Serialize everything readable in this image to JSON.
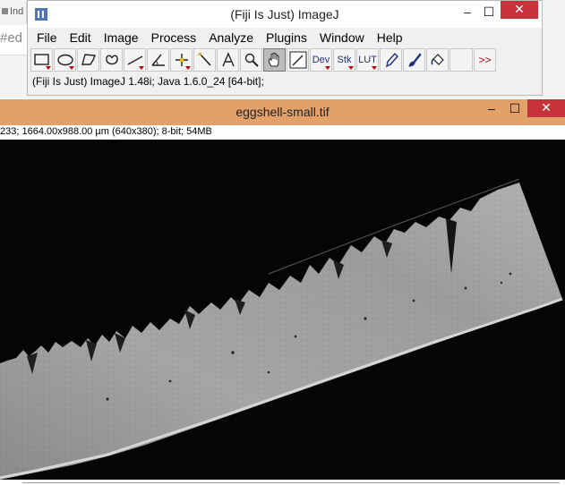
{
  "background_window": {
    "tab_label": "Ind",
    "field_text": "#ed"
  },
  "imagej": {
    "title": "(Fiji Is Just) ImageJ",
    "controls": {
      "minimize": "–",
      "maximize": "☐",
      "close": "✕"
    },
    "menu": [
      "File",
      "Edit",
      "Image",
      "Process",
      "Analyze",
      "Plugins",
      "Window",
      "Help"
    ],
    "tools": {
      "dev_label": "Dev",
      "stk_label": "Stk",
      "lut_label": "LUT",
      "more_label": ">>",
      "icons": [
        "rectangle-icon",
        "oval-icon",
        "polygon-icon",
        "freehand-icon",
        "line-icon",
        "angle-icon",
        "point-icon",
        "wand-icon",
        "text-icon",
        "magnifier-icon",
        "hand-icon",
        "color-picker-icon",
        "dev-menu",
        "stk-menu",
        "lut-menu",
        "pencil-icon",
        "brush-icon",
        "flood-fill-icon",
        "empty-slot",
        "more-tools-icon"
      ],
      "active": "hand-icon"
    },
    "status": "(Fiji Is Just) ImageJ 1.48i; Java 1.6.0_24 [64-bit];"
  },
  "image_window": {
    "title": "eggshell-small.tif",
    "info": "233; 1664.00x988.00 µm (640x380); 8-bit; 54MB",
    "controls": {
      "minimize": "–",
      "maximize": "☐",
      "close": "✕"
    },
    "title_color": "#e3a069",
    "close_color": "#c7333b"
  }
}
